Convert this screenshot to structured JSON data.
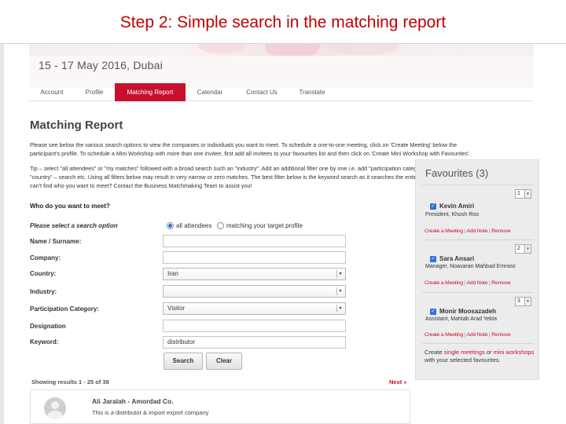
{
  "slide": {
    "title": "Step 2: Simple search in the matching report"
  },
  "event": {
    "date_place": "15 - 17 May 2016, Dubai"
  },
  "nav": {
    "items": [
      {
        "label": "Account",
        "active": false
      },
      {
        "label": "Profile",
        "active": false
      },
      {
        "label": "Matching Report",
        "active": true
      },
      {
        "label": "Calendar",
        "active": false
      },
      {
        "label": "Contact Us",
        "active": false
      },
      {
        "label": "Translate",
        "active": false
      }
    ]
  },
  "page": {
    "heading": "Matching Report",
    "intro_1": "Please see below the various search options to view the companies or individuals you want to meet. To schedule a one-to-one meeting, click on 'Create Meeting' below the",
    "intro_2": "participant's profile. To schedule a Mini Workshop with more than one invitee, first add all invitees to your favourites list and then click on 'Create Mini Workshop with Favourites'.",
    "tip_1": "Tip – select \"all attendees\" or \"my matches\" followed with a broad search such an \"industry\". Add an additional filter one by one i.e. add \"participation category\" – search – then add",
    "tip_2": "\"country\" – search etc. Using all filters below may result in very narrow or zero matches. The best filter below is the keyword search as it searches the entire profile for matches. Still",
    "tip_3": "can't find who you want to meet? Contact the Business Matchmaking Team to assist you!"
  },
  "search": {
    "heading": "Who do you want to meet?",
    "option_label": "Please select a search option",
    "radio_all": "all attendees",
    "radio_matching": "matching your target profile",
    "name_label": "Name / Surname:",
    "company_label": "Company:",
    "country_label": "Country:",
    "country_value": "Iran",
    "industry_label": "Industry:",
    "industry_value": "",
    "category_label": "Participation Category:",
    "category_value": "Visitor",
    "designation_label": "Designation",
    "keyword_label": "Keyword:",
    "keyword_value": "distributor",
    "search_button": "Search",
    "clear_button": "Clear"
  },
  "results": {
    "showing": "Showing results 1 - 25 of 38",
    "next": "Next »",
    "first": {
      "name": "Ali Jaralah - Amordad Co.",
      "description": "This is a distributor & import export company"
    }
  },
  "favourites": {
    "title": "Favourites (3)",
    "items": [
      {
        "order": "1",
        "name": "Kevin Amiri",
        "role": "President, Khosh Roo"
      },
      {
        "order": "2",
        "name": "Sara Ansari",
        "role": "Manager, Noavaran Mahbad Emrooz"
      },
      {
        "order": "3",
        "name": "Monir Moosazadeh",
        "role": "Assistant, Mahtab Arad Yekta"
      }
    ],
    "action_create": "Create a Meeting",
    "action_add_note": "Add Note",
    "action_remove": "Remove",
    "pipe": "|",
    "foot_1": "Create ",
    "foot_single": "single meetings",
    "foot_or": " or ",
    "foot_mini": "mini workshops",
    "foot_2": " with your selected favourites."
  },
  "colors": {
    "brand": "#c8102e",
    "title": "#c00000",
    "checkbox": "#2f6fd6"
  }
}
